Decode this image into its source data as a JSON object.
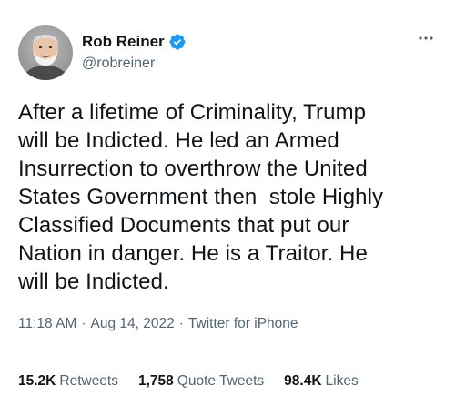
{
  "user": {
    "display_name": "Rob Reiner",
    "handle": "@robreiner",
    "verified": true
  },
  "tweet": {
    "text": "After a lifetime of Criminality, Trump\nwill be Indicted. He led an Armed\nInsurrection to overthrow the United\nStates Government then  stole Highly\nClassified Documents that put our\nNation in danger. He is a Traitor. He\nwill be Indicted."
  },
  "meta": {
    "time": "11:18 AM",
    "sep1": "·",
    "date": "Aug 14, 2022",
    "sep2": "·",
    "source": "Twitter for iPhone"
  },
  "stats": {
    "retweets_count": "15.2K",
    "retweets_label": "Retweets",
    "quotes_count": "1,758",
    "quotes_label": "Quote Tweets",
    "likes_count": "98.4K",
    "likes_label": "Likes"
  },
  "colors": {
    "verified": "#1d9bf0",
    "secondary_text": "#536471",
    "primary_text": "#0f1419"
  }
}
